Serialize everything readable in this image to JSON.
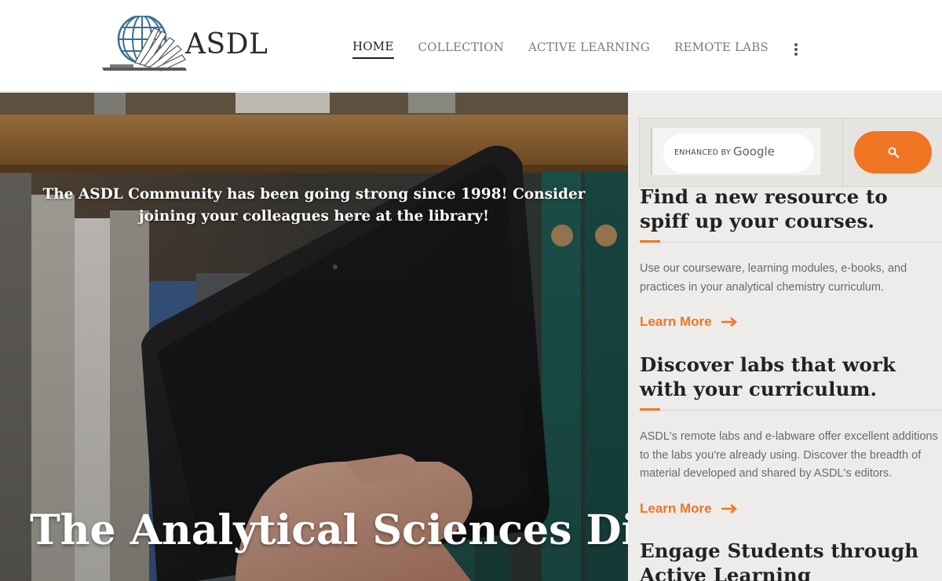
{
  "brand": {
    "name": "ASDL"
  },
  "nav": {
    "items": [
      {
        "label": "HOME",
        "active": true
      },
      {
        "label": "COLLECTION",
        "active": false
      },
      {
        "label": "ACTIVE LEARNING",
        "active": false
      },
      {
        "label": "REMOTE LABS",
        "active": false
      }
    ],
    "more_icon": "vertical-dots-icon"
  },
  "hero": {
    "intro": "The ASDL Community has been going strong since 1998! Consider joining your colleagues here at the library!",
    "title": "The Analytical Sciences Digital Library"
  },
  "search": {
    "enhanced_by": "ENHANCED BY",
    "provider": "Google",
    "button_icon": "search-icon"
  },
  "sections": [
    {
      "title": "Find a new resource to spiff up your courses.",
      "body": "Use our courseware, learning modules, e-books, and practices in your analytical chemistry curriculum.",
      "link": "Learn More"
    },
    {
      "title": "Discover labs that work with your curriculum.",
      "body": "ASDL's remote labs and e-labware offer excellent additions to the labs you're already using. Discover the breadth of material developed and shared by ASDL's editors.",
      "link": "Learn More"
    },
    {
      "title": "Engage Students through Active Learning"
    }
  ],
  "colors": {
    "accent": "#f07523",
    "sidebar_bg": "#eeecea",
    "heading": "#222222",
    "body_text": "#6a6a6a"
  }
}
